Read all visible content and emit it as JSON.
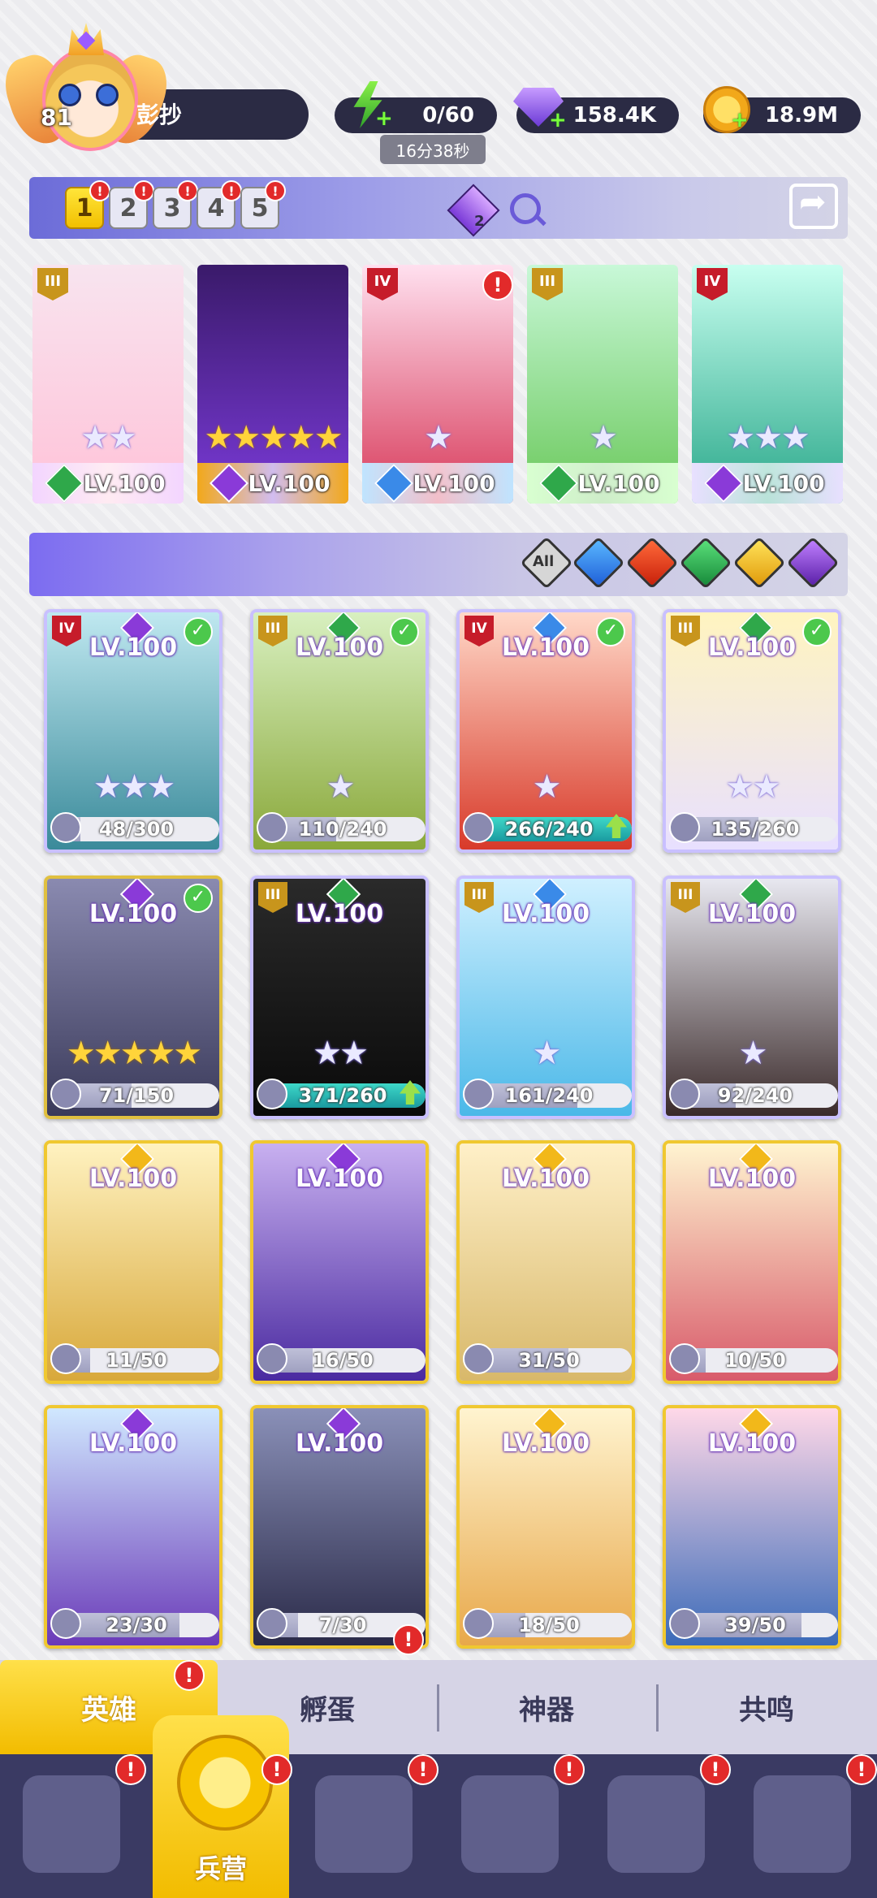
{
  "player": {
    "level": "81",
    "name": "彭抄"
  },
  "resources": {
    "energy": "0/60",
    "energy_timer": "16分38秒",
    "gems": "158.4K",
    "coins": "18.9M"
  },
  "team_tabs": [
    "1",
    "2",
    "3",
    "4",
    "5"
  ],
  "team_gem_count": "2",
  "team_heroes": [
    {
      "tier": "III",
      "tier_color": "gold",
      "level": "LV.100",
      "stars": "★★",
      "star_style": "w",
      "element": "earth",
      "bar": "#f3d5ff",
      "art": [
        "#f8e4ef",
        "#ffc2d8"
      ]
    },
    {
      "tier": "",
      "tier_color": "",
      "level": "LV.100",
      "stars": "★★★★★",
      "star_style": "y",
      "element": "dark",
      "bar": "#f2a81a",
      "art": [
        "#3a1a6a",
        "#7a3ad8"
      ]
    },
    {
      "tier": "IV",
      "tier_color": "red",
      "level": "LV.100",
      "stars": "★",
      "star_style": "w",
      "element": "water",
      "bar": "#bfe4ff",
      "art": [
        "#ffe0ef",
        "#d83a5a"
      ]
    },
    {
      "tier": "III",
      "tier_color": "gold",
      "level": "LV.100",
      "stars": "★",
      "star_style": "w",
      "element": "earth",
      "bar": "#d8ffd0",
      "art": [
        "#c8f8d8",
        "#6ac85a"
      ]
    },
    {
      "tier": "IV",
      "tier_color": "red",
      "level": "LV.100",
      "stars": "★★★",
      "star_style": "w",
      "element": "dark",
      "bar": "#e8e0ff",
      "art": [
        "#c8fff0",
        "#2aa88a"
      ]
    }
  ],
  "filter": {
    "all_label": "All",
    "elements": [
      "water",
      "fire",
      "earth",
      "light",
      "dark"
    ]
  },
  "heroes": [
    {
      "level": "LV.100",
      "tier": "IV",
      "tier_color": "red",
      "element": "dark",
      "checked": true,
      "stars": "★★★",
      "star_style": "w",
      "frag": "48/300",
      "frag_pct": 16,
      "full": false,
      "up": false,
      "art": [
        "#bfe8f0",
        "#3a8a9a"
      ],
      "frame": "#c9c0ff"
    },
    {
      "level": "LV.100",
      "tier": "III",
      "tier_color": "gold",
      "element": "earth",
      "checked": true,
      "stars": "★",
      "star_style": "w",
      "frag": "110/240",
      "frag_pct": 46,
      "full": false,
      "up": false,
      "art": [
        "#d8f0c0",
        "#8aa83a"
      ],
      "frame": "#c9c0ff"
    },
    {
      "level": "LV.100",
      "tier": "IV",
      "tier_color": "red",
      "element": "water",
      "checked": true,
      "stars": "★",
      "star_style": "w",
      "frag": "266/240",
      "frag_pct": 100,
      "full": true,
      "up": true,
      "art": [
        "#ffd8c8",
        "#d83a2a"
      ],
      "frame": "#c9c0ff"
    },
    {
      "level": "LV.100",
      "tier": "III",
      "tier_color": "gold",
      "element": "earth",
      "checked": true,
      "stars": "★★",
      "star_style": "w",
      "frag": "135/260",
      "frag_pct": 52,
      "full": false,
      "up": false,
      "art": [
        "#fff4c0",
        "#e8e0ff"
      ],
      "frame": "#c9c0ff"
    },
    {
      "level": "LV.100",
      "tier": "",
      "tier_color": "",
      "element": "dark",
      "checked": true,
      "stars": "★★★★★",
      "star_style": "y",
      "frag": "71/150",
      "frag_pct": 47,
      "full": false,
      "up": false,
      "art": [
        "#8a8ab0",
        "#3a3a5a"
      ],
      "frame": "#e0c040"
    },
    {
      "level": "LV.100",
      "tier": "III",
      "tier_color": "gold",
      "element": "earth",
      "checked": false,
      "stars": "★★",
      "star_style": "w",
      "frag": "371/260",
      "frag_pct": 100,
      "full": true,
      "up": true,
      "art": [
        "#2a2a2a",
        "#0a0a0a"
      ],
      "frame": "#c9c0ff"
    },
    {
      "level": "LV.100",
      "tier": "III",
      "tier_color": "gold",
      "element": "water",
      "checked": false,
      "stars": "★",
      "star_style": "w",
      "frag": "161/240",
      "frag_pct": 67,
      "full": false,
      "up": false,
      "art": [
        "#d0f0ff",
        "#4ab8e8"
      ],
      "frame": "#c9c0ff"
    },
    {
      "level": "LV.100",
      "tier": "III",
      "tier_color": "gold",
      "element": "earth",
      "checked": false,
      "stars": "★",
      "star_style": "w",
      "frag": "92/240",
      "frag_pct": 38,
      "full": false,
      "up": false,
      "art": [
        "#e8e8f0",
        "#3a2a2a"
      ],
      "frame": "#c9c0ff"
    },
    {
      "level": "LV.100",
      "tier": "",
      "tier_color": "",
      "element": "light",
      "checked": false,
      "stars": "",
      "star_style": "y",
      "frag": "11/50",
      "frag_pct": 22,
      "full": false,
      "up": false,
      "art": [
        "#fff2c0",
        "#d8a83a"
      ],
      "frame": "#f0c830"
    },
    {
      "level": "LV.100",
      "tier": "",
      "tier_color": "",
      "element": "dark",
      "checked": false,
      "stars": "",
      "star_style": "y",
      "frag": "16/50",
      "frag_pct": 32,
      "full": false,
      "up": false,
      "art": [
        "#c8b0f0",
        "#4a2aa0"
      ],
      "frame": "#f0c830"
    },
    {
      "level": "LV.100",
      "tier": "",
      "tier_color": "",
      "element": "light",
      "checked": false,
      "stars": "",
      "star_style": "y",
      "frag": "31/50",
      "frag_pct": 62,
      "full": false,
      "up": false,
      "art": [
        "#fff0c8",
        "#d8b86a"
      ],
      "frame": "#f0c830"
    },
    {
      "level": "LV.100",
      "tier": "",
      "tier_color": "",
      "element": "light",
      "checked": false,
      "stars": "",
      "star_style": "y",
      "frag": "10/50",
      "frag_pct": 20,
      "full": false,
      "up": false,
      "art": [
        "#fff4d0",
        "#d85a6a"
      ],
      "frame": "#f0c830"
    },
    {
      "level": "LV.100",
      "tier": "",
      "tier_color": "",
      "element": "dark",
      "checked": false,
      "stars": "",
      "star_style": "y",
      "frag": "23/30",
      "frag_pct": 76,
      "full": false,
      "up": false,
      "art": [
        "#d0e8ff",
        "#6a3ab8"
      ],
      "frame": "#f0c830"
    },
    {
      "level": "LV.100",
      "tier": "",
      "tier_color": "",
      "element": "dark",
      "checked": false,
      "stars": "",
      "star_style": "y",
      "frag": "7/30",
      "frag_pct": 23,
      "full": false,
      "up": false,
      "art": [
        "#8a90b8",
        "#2a2a48"
      ],
      "frame": "#f0c830"
    },
    {
      "level": "LV.100",
      "tier": "",
      "tier_color": "",
      "element": "light",
      "checked": false,
      "stars": "",
      "star_style": "y",
      "frag": "18/50",
      "frag_pct": 36,
      "full": false,
      "up": false,
      "art": [
        "#fff4d0",
        "#e8a84a"
      ],
      "frame": "#f0c830"
    },
    {
      "level": "LV.100",
      "tier": "",
      "tier_color": "",
      "element": "light",
      "checked": false,
      "stars": "",
      "star_style": "y",
      "frag": "39/50",
      "frag_pct": 78,
      "full": false,
      "up": false,
      "art": [
        "#ffd8e8",
        "#3a6ab8"
      ],
      "frame": "#f0c830"
    }
  ],
  "tabs": [
    {
      "label": "英雄",
      "active": true,
      "alert": true
    },
    {
      "label": "孵蛋",
      "active": false,
      "alert": true
    },
    {
      "label": "神器",
      "active": false,
      "alert": false
    },
    {
      "label": "共鸣",
      "active": false,
      "alert": false
    }
  ],
  "nav": {
    "active_label": "兵营",
    "items": [
      "cards-icon",
      "barracks-icon",
      "map-icon",
      "castle-icon",
      "mushroom-icon",
      "banner-icon"
    ]
  },
  "colors": {
    "water": "#3a8ae8",
    "fire": "#e8402a",
    "earth": "#2fa84a",
    "light": "#f2b81a",
    "dark": "#8a3ad8"
  }
}
